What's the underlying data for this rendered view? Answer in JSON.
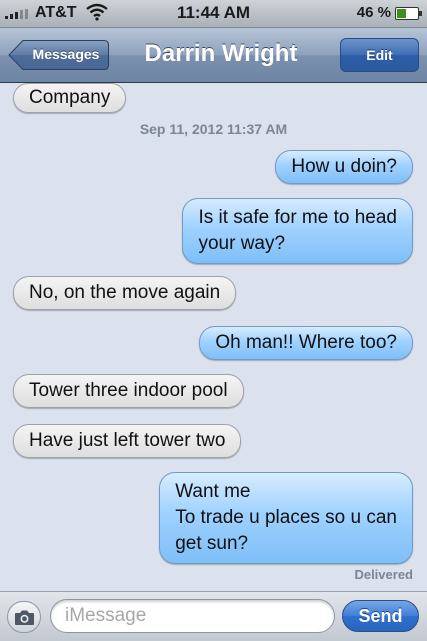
{
  "status_bar": {
    "carrier": "AT&T",
    "time": "11:44 AM",
    "battery": "46 %",
    "battery_level": 0.46,
    "icons": [
      "signal-bars-icon",
      "wifi-icon",
      "battery-icon"
    ]
  },
  "nav": {
    "back_label": "Messages",
    "title": "Darrin Wright",
    "edit_label": "Edit"
  },
  "conversation": {
    "messages": [
      {
        "direction": "in",
        "text": "Company"
      },
      {
        "type": "timestamp",
        "text": "Sep 11, 2012 11:37 AM"
      },
      {
        "direction": "out",
        "text": "How u doin?"
      },
      {
        "direction": "out",
        "lines": [
          "Is it safe for me to head",
          "your way?"
        ]
      },
      {
        "direction": "in",
        "text": "No, on the move again"
      },
      {
        "direction": "out",
        "text": "Oh man!! Where too?"
      },
      {
        "direction": "in",
        "text": "Tower three indoor pool"
      },
      {
        "direction": "in",
        "text": "Have just left tower two"
      },
      {
        "direction": "out",
        "lines": [
          "Want me",
          "To trade u places so u can",
          "get sun?"
        ]
      }
    ],
    "delivered": "Delivered"
  },
  "input_bar": {
    "placeholder": "iMessage",
    "send_label": "Send",
    "camera_icon": "camera-icon"
  },
  "colors": {
    "background": "#dbe2ed",
    "outgoing_bubble": "#9fd1ff",
    "incoming_bubble": "#e8e8e8",
    "nav_bar": "#7b91ae",
    "send_button": "#3f7ed8"
  }
}
